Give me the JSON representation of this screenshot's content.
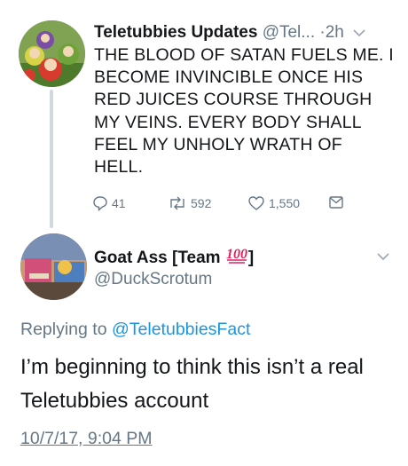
{
  "tweet1": {
    "display_name": "Teletubbies Updates",
    "handle": "@Tel...",
    "separator": "·",
    "time": "2h",
    "text": "THE BLOOD OF SATAN FUELS ME. I BECOME INVINCIBLE ONCE HIS RED JUICES COURSE THROUGH MY VEINS. EVERY BODY SHALL FEEL MY UNHOLY WRATH OF HELL.",
    "reply_count": "41",
    "retweet_count": "592",
    "like_count": "1,550",
    "icons": [
      "reply-icon",
      "retweet-icon",
      "like-icon",
      "message-icon",
      "chevron-down-icon"
    ]
  },
  "tweet2": {
    "display_name": "Goat Ass [Team",
    "name_suffix": "]",
    "name_emoji": "hundred-points-emoji",
    "handle": "@DuckScrotum",
    "replying_prefix": "Replying to",
    "replying_to": "@TeletubbiesFact",
    "text": "I’m beginning to think this isn’t a real Teletubbies account",
    "timestamp": "10/7/17, 9:04 PM"
  },
  "colors": {
    "text": "#14171a",
    "secondary": "#657786",
    "link": "#1b95e0",
    "emoji_red": "#e0245e"
  }
}
